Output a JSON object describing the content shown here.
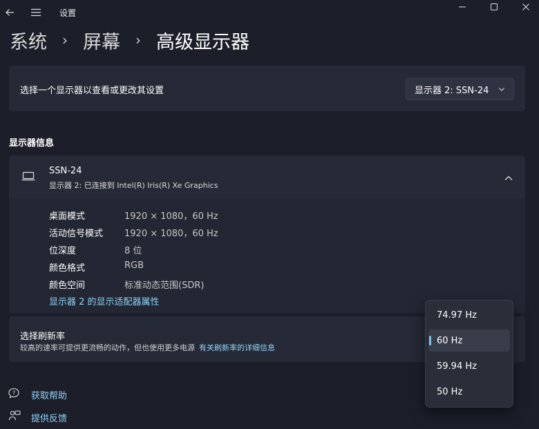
{
  "window": {
    "title": "设置",
    "back_icon": "back-arrow-icon",
    "menu_icon": "hamburger-menu-icon"
  },
  "breadcrumb": {
    "items": [
      "系统",
      "屏幕"
    ],
    "current": "高级显示器",
    "separator": "›"
  },
  "display_select": {
    "label": "选择一个显示器以查看或更改其设置",
    "selected": "显示器 2: SSN-24"
  },
  "display_info": {
    "section_title": "显示器信息",
    "name": "SSN-24",
    "subtitle": "显示器 2: 已连接到 Intel(R) Iris(R) Xe Graphics",
    "rows": [
      {
        "key": "桌面模式",
        "value": "1920 × 1080，60 Hz"
      },
      {
        "key": "活动信号模式",
        "value": "1920 × 1080，60 Hz"
      },
      {
        "key": "位深度",
        "value": "8 位"
      },
      {
        "key": "颜色格式",
        "value": "RGB"
      },
      {
        "key": "颜色空间",
        "value": "标准动态范围(SDR)"
      }
    ],
    "adapter_link": "显示器 2 的显示适配器属性"
  },
  "refresh_rate": {
    "title": "选择刷新率",
    "description": "较高的速率可提供更流畅的动作，但也使用更多电源",
    "details_link": "有关刷新率的详细信息",
    "options": [
      "74.97 Hz",
      "60 Hz",
      "59.94 Hz",
      "50 Hz"
    ],
    "selected": "60 Hz"
  },
  "footer": {
    "help": "获取帮助",
    "feedback": "提供反馈"
  },
  "colors": {
    "background": "#1c1f2a",
    "card": "#262a36",
    "accent_link": "#8fd3f6",
    "selected_indicator": "#78c6f0"
  }
}
